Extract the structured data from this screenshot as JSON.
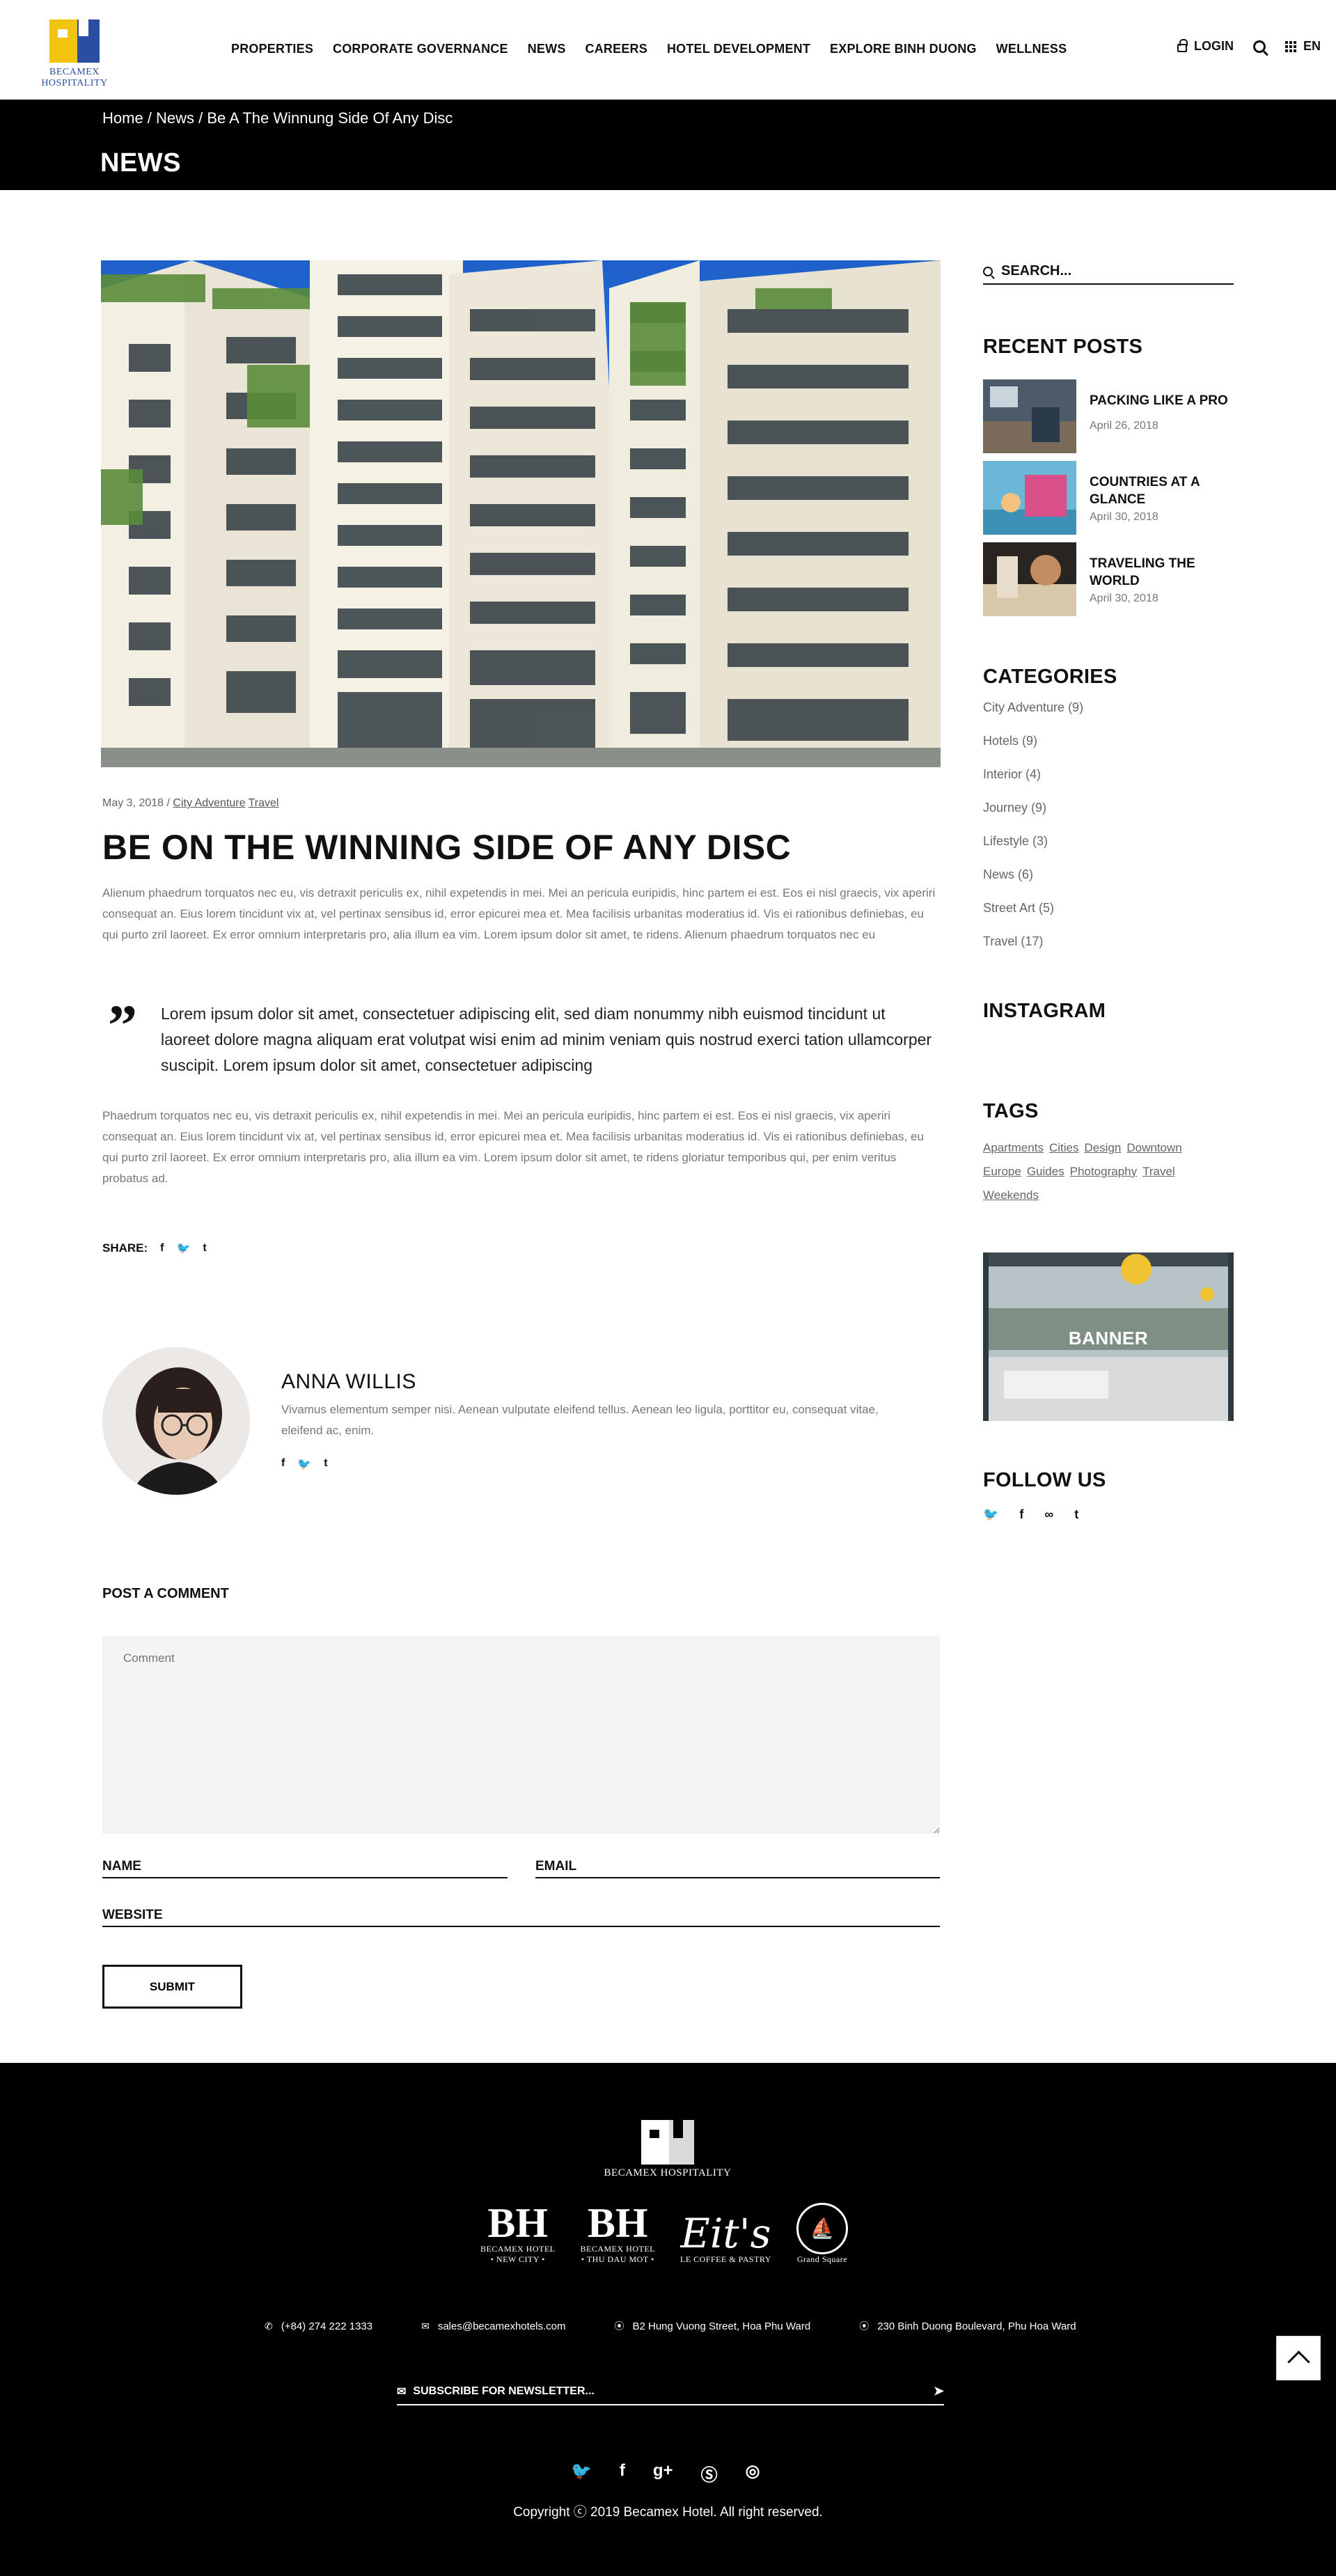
{
  "header": {
    "logo_text": "BECAMEX HOSPITALITY",
    "nav": [
      "PROPERTIES",
      "CORPORATE GOVERNANCE",
      "NEWS",
      "CAREERS",
      "HOTEL DEVELOPMENT",
      "EXPLORE BINH DUONG",
      "WELLNESS"
    ],
    "login_label": "LOGIN",
    "lang_label": "EN"
  },
  "titlebar": {
    "breadcrumb": "Home / News / Be A The Winnung Side Of Any Disc",
    "title": "NEWS"
  },
  "post": {
    "date": "May 3, 2018",
    "meta_sep": " / ",
    "categories": [
      "City Adventure",
      "Travel"
    ],
    "title": "BE ON THE WINNING SIDE OF ANY DISC",
    "para1": "Alienum phaedrum torquatos nec eu, vis detraxit periculis ex, nihil expetendis in mei. Mei an pericula euripidis, hinc partem ei est. Eos ei nisl graecis, vix aperiri consequat an. Eius lorem tincidunt vix at, vel pertinax sensibus id, error epicurei mea et. Mea facilisis urbanitas moderatius id. Vis ei rationibus definiebas, eu qui purto zril laoreet. Ex error omnium interpretaris pro, alia illum ea vim. Lorem ipsum dolor sit amet, te ridens. Alienum phaedrum torquatos nec eu",
    "quote": "Lorem ipsum dolor sit amet, consectetuer adipiscing elit, sed diam nonummy nibh euismod tincidunt ut laoreet dolore magna aliquam erat volutpat wisi enim ad minim veniam quis nostrud exerci tation ullamcorper suscipit. Lorem ipsum dolor sit amet, consectetuer adipiscing",
    "para2": "Phaedrum torquatos nec eu, vis detraxit periculis ex, nihil expetendis in mei. Mei an pericula euripidis, hinc partem ei est. Eos ei nisl graecis, vix aperiri consequat an. Eius lorem tincidunt vix at, vel pertinax sensibus id, error epicurei mea et. Mea facilisis urbanitas moderatius id. Vis ei rationibus definiebas, eu qui purto zril laoreet. Ex error omnium interpretaris pro, alia illum ea vim. Lorem ipsum dolor sit amet, te ridens gloriatur temporibus qui, per enim veritus probatus ad.",
    "share_label": "SHARE:",
    "share_icons": [
      "f",
      "t-bird",
      "t"
    ]
  },
  "author": {
    "name": "ANNA WILLIS",
    "bio": "Vivamus elementum semper nisi. Aenean vulputate eleifend tellus. Aenean leo ligula, porttitor eu, consequat vitae, eleifend ac, enim."
  },
  "comment_form": {
    "heading": "POST A COMMENT",
    "comment_placeholder": "Comment",
    "name_label": "NAME",
    "email_label": "EMAIL",
    "website_label": "WEBSITE",
    "submit_label": "SUBMIT"
  },
  "sidebar": {
    "search_placeholder": "SEARCH...",
    "recent_heading": "RECENT POSTS",
    "recent_posts": [
      {
        "title": "PACKING LIKE A PRO",
        "date": "April 26, 2018"
      },
      {
        "title": "COUNTRIES AT A GLANCE",
        "date": "April 30, 2018"
      },
      {
        "title": "TRAVELING THE WORLD",
        "date": "April 30, 2018"
      }
    ],
    "categories_heading": "CATEGORIES",
    "categories": [
      "City Adventure (9)",
      "Hotels (9)",
      "Interior (4)",
      "Journey (9)",
      "Lifestyle (3)",
      "News (6)",
      "Street Art (5)",
      "Travel (17)"
    ],
    "instagram_heading": "INSTAGRAM",
    "tags_heading": "TAGS",
    "tags": [
      "Apartments",
      "Cities",
      "Design",
      "Downtown",
      "Europe",
      "Guides",
      "Photography",
      "Travel",
      "Weekends"
    ],
    "banner_label": "BANNER",
    "follow_heading": "FOLLOW US"
  },
  "footer": {
    "logo_text": "BECAMEX HOSPITALITY",
    "partners": [
      {
        "name": "BECAMEX HOTEL",
        "sub": "• NEW CITY •"
      },
      {
        "name": "BECAMEX HOTEL",
        "sub": "• THU DAU MOT •"
      },
      {
        "name": "LE COFFEE & PASTRY",
        "mark": "Eit's"
      },
      {
        "name": "Grand Square"
      }
    ],
    "phone": "(+84) 274 222 1333",
    "email": "sales@becamexhotels.com",
    "address1": "B2 Hung Vuong Street, Hoa Phu Ward",
    "address2": "230 Binh Duong Boulevard, Phu Hoa Ward",
    "newsletter_placeholder": "SUBSCRIBE FOR NEWSLETTER...",
    "copyright": "Copyright ⓒ 2019 Becamex Hotel. All right reserved."
  }
}
